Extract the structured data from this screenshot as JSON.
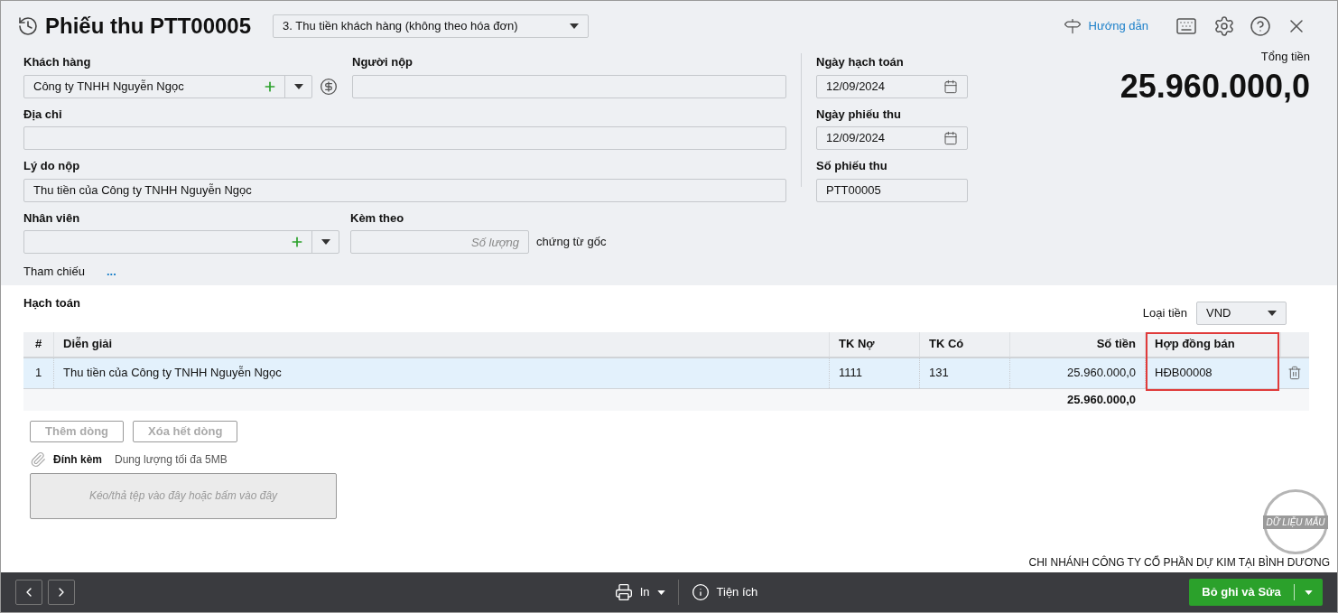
{
  "header": {
    "title": "Phiếu thu PTT00005",
    "voucher_type": "3. Thu tiền khách hàng (không theo hóa đơn)",
    "guide_link": "Hướng dẫn"
  },
  "form": {
    "customer": {
      "label": "Khách hàng",
      "value": "Công ty TNHH Nguyễn Ngọc"
    },
    "payer": {
      "label": "Người nộp"
    },
    "address": {
      "label": "Địa chỉ"
    },
    "reason": {
      "label": "Lý do nộp",
      "value": "Thu tiền của Công ty TNHH Nguyễn Ngọc"
    },
    "employee": {
      "label": "Nhân viên"
    },
    "attached": {
      "label": "Kèm theo",
      "placeholder": "Số lượng",
      "suffix": "chứng từ gốc"
    },
    "reference": {
      "label": "Tham chiếu",
      "link": "..."
    },
    "posting_date": {
      "label": "Ngày hạch toán",
      "value": "12/09/2024"
    },
    "receipt_date": {
      "label": "Ngày phiếu thu",
      "value": "12/09/2024"
    },
    "receipt_no": {
      "label": "Số phiếu thu",
      "value": "PTT00005"
    },
    "total": {
      "label": "Tổng tiền",
      "value": "25.960.000,0"
    }
  },
  "accounting": {
    "title": "Hạch toán",
    "currency": {
      "label": "Loại tiền",
      "value": "VND"
    },
    "columns": [
      {
        "label": "#",
        "highlighted": false
      },
      {
        "label": "Diễn giải",
        "highlighted": false
      },
      {
        "label": "TK Nợ",
        "highlighted": false
      },
      {
        "label": "TK Có",
        "highlighted": false
      },
      {
        "label": "Số tiền",
        "highlighted": false
      },
      {
        "label": "Hợp đồng bán",
        "highlighted": true
      }
    ],
    "rows": [
      {
        "selected": true,
        "cells": [
          "1",
          "Thu tiền của Công ty TNHH Nguyễn Ngọc",
          "1111",
          "131",
          "25.960.000,0",
          "HĐB00008"
        ]
      }
    ],
    "total_amount": "25.960.000,0",
    "buttons": [
      {
        "label": "Thêm dòng",
        "disabled": true
      },
      {
        "label": "Xóa hết dòng",
        "disabled": true
      }
    ]
  },
  "attachment": {
    "label": "Đính kèm",
    "hint": "Dung lượng tối đa 5MB",
    "dropzone": "Kéo/thả tệp vào đây hoặc bấm vào đây"
  },
  "stamp": "DỮ LIỆU MẪU",
  "company": "CHI NHÁNH CÔNG TY CỔ PHẦN DỰ KIM TẠI BÌNH DƯƠNG",
  "footer": {
    "print": "In",
    "utilities": "Tiện ích",
    "save": "Bỏ ghi và Sửa"
  }
}
